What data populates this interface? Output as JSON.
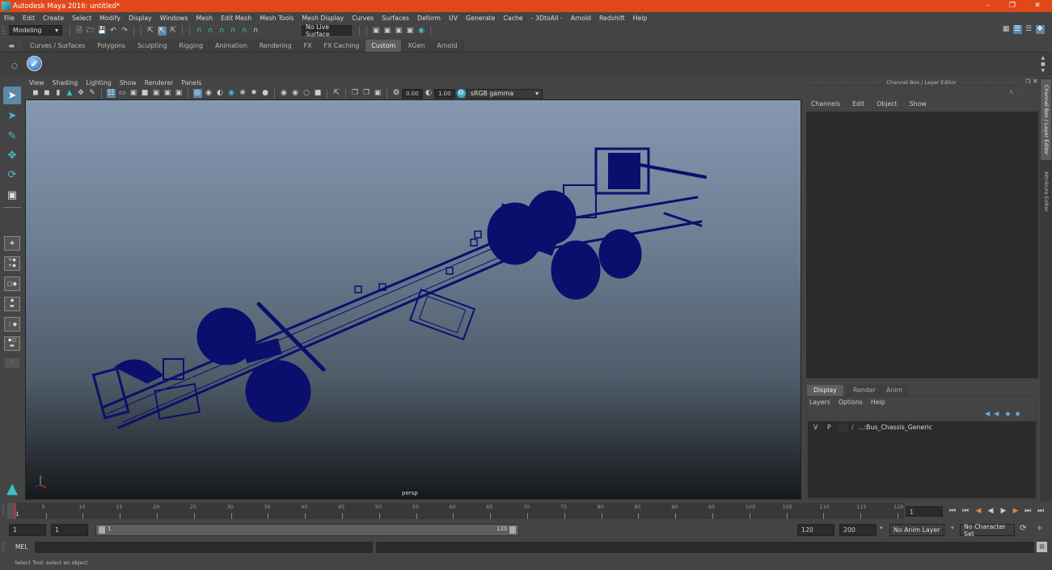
{
  "window": {
    "title": "Autodesk Maya 2016: untitled*",
    "controls": [
      "minimize",
      "restore",
      "close"
    ]
  },
  "menubar": [
    "File",
    "Edit",
    "Create",
    "Select",
    "Modify",
    "Display",
    "Windows",
    "Mesh",
    "Edit Mesh",
    "Mesh Tools",
    "Mesh Display",
    "Curves",
    "Surfaces",
    "Deform",
    "UV",
    "Generate",
    "Cache",
    "- 3DtoAll -",
    "Arnold",
    "Redshift",
    "Help"
  ],
  "statusline": {
    "menu_set": "Modeling",
    "live_surface": "No Live Surface"
  },
  "shelf": {
    "tabs": [
      "Curves / Surfaces",
      "Polygons",
      "Sculpting",
      "Rigging",
      "Animation",
      "Rendering",
      "FX",
      "FX Caching",
      "Custom",
      "XGen",
      "Arnold"
    ],
    "active_tab": "Custom"
  },
  "viewport": {
    "menu": [
      "View",
      "Shading",
      "Lighting",
      "Show",
      "Renderer",
      "Panels"
    ],
    "exposure": "0.00",
    "gamma": "1.00",
    "color_space": "sRGB gamma",
    "camera_label": "persp",
    "wire_color": "#0a0f6e",
    "axis": {
      "y": "y",
      "x": "x",
      "z": "z"
    }
  },
  "channel_box": {
    "title": "Channel Box / Layer Editor",
    "menu": [
      "Channels",
      "Edit",
      "Object",
      "Show"
    ]
  },
  "side_tabs": [
    "Channel Box / Layer Editor",
    "Attribute Editor"
  ],
  "layer_editor": {
    "tabs": [
      "Display",
      "Render",
      "Anim"
    ],
    "active_tab": "Display",
    "menu": [
      "Layers",
      "Options",
      "Help"
    ],
    "layers": [
      {
        "v": "V",
        "p": "P",
        "name": "...:Bus_Chassis_Generic"
      }
    ]
  },
  "timeline": {
    "ticks": [
      5,
      10,
      15,
      20,
      25,
      30,
      35,
      40,
      45,
      50,
      55,
      60,
      65,
      70,
      75,
      80,
      85,
      90,
      95,
      100,
      105,
      110,
      115,
      120
    ],
    "start_marker": "1",
    "current_frame": "1",
    "min": 1,
    "max": 120
  },
  "range": {
    "start_field": "1",
    "playback_start": "1",
    "range_start_label": "1",
    "range_end_label": "120",
    "playback_end": "120",
    "end_field": "200",
    "anim_layer": "No Anim Layer",
    "character_set": "No Character Set"
  },
  "command_line": {
    "language": "MEL",
    "value": ""
  },
  "help_line": "Select Tool: select an object"
}
